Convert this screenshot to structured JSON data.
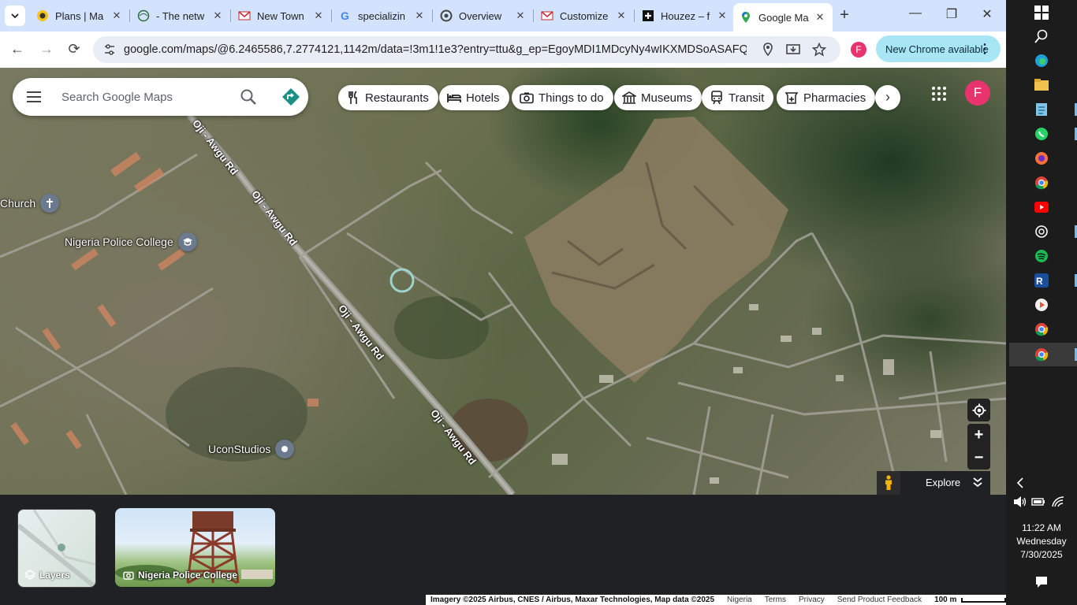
{
  "browser": {
    "tabs": [
      {
        "title": "Plans | Ma",
        "favicon": "plans-favicon"
      },
      {
        "title": "- The netw",
        "favicon": "globe-favicon"
      },
      {
        "title": "New Town",
        "favicon": "red-envelope-favicon"
      },
      {
        "title": "specializin",
        "favicon": "google-favicon"
      },
      {
        "title": "Overview",
        "favicon": "openai-favicon"
      },
      {
        "title": "Customize",
        "favicon": "red-envelope-favicon"
      },
      {
        "title": "Houzez – f",
        "favicon": "houzez-favicon"
      },
      {
        "title": "Google Ma",
        "favicon": "google-maps-favicon",
        "active": true
      }
    ],
    "url": "google.com/maps/@6.2465586,7.2774121,1142m/data=!3m1!1e3?entry=ttu&g_ep=EgoyMDI1MDcyNy4wIKXMDSoASAFQAw...",
    "profile_initial": "F",
    "new_chrome_label": "New Chrome available"
  },
  "maps": {
    "search_placeholder": "Search Google Maps",
    "chips": [
      {
        "label": "Restaurants",
        "icon": "fork-knife-icon"
      },
      {
        "label": "Hotels",
        "icon": "bed-icon"
      },
      {
        "label": "Things to do",
        "icon": "camera-icon"
      },
      {
        "label": "Museums",
        "icon": "museum-icon"
      },
      {
        "label": "Transit",
        "icon": "train-icon"
      },
      {
        "label": "Pharmacies",
        "icon": "pharmacy-icon"
      }
    ],
    "account_initial": "F",
    "road_labels": [
      "Oji - Awgu Rd",
      "Oji - Awgu Rd",
      "Oji - Awgu Rd",
      "Oji - Awgu Rd"
    ],
    "places": [
      {
        "name": "Church",
        "icon": "church-icon"
      },
      {
        "name": "Nigeria Police College",
        "icon": "school-icon"
      },
      {
        "name": "UconStudios",
        "icon": "place-pin-icon"
      }
    ],
    "explore_label": "Explore",
    "layers_label": "Layers",
    "photo_label": "Nigeria Police College",
    "attribution": {
      "imagery": "Imagery ©2025 Airbus, CNES / Airbus, Maxar Technologies, Map data ©2025",
      "region": "Nigeria",
      "terms": "Terms",
      "privacy": "Privacy",
      "feedback": "Send Product Feedback",
      "scale": "100 m"
    }
  },
  "taskbar": {
    "time": "11:22 AM",
    "day": "Wednesday",
    "date": "7/30/2025"
  },
  "colors": {
    "tabstrip": "#d3e3fd",
    "account": "#e8336f",
    "new_chrome": "#a8e6f5"
  }
}
